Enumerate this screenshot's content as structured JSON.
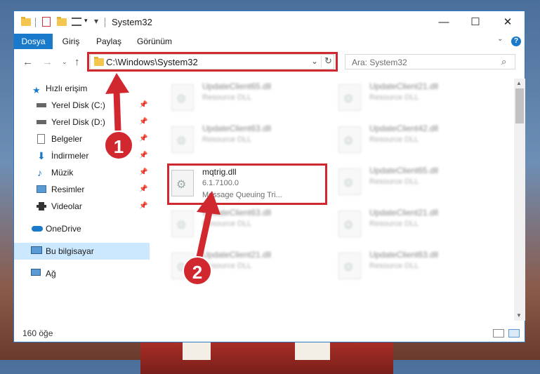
{
  "window": {
    "title": "System32"
  },
  "ribbon": {
    "tabs": [
      "Dosya",
      "Giriş",
      "Paylaş",
      "Görünüm"
    ],
    "help_label": "?"
  },
  "address": {
    "path": "C:\\Windows\\System32",
    "search_placeholder": "Ara: System32"
  },
  "sidebar": {
    "items": [
      {
        "label": "Hızlı erişim",
        "icon": "star-icon",
        "pinned": false
      },
      {
        "label": "Yerel Disk (C:)",
        "icon": "drive-icon",
        "pinned": true
      },
      {
        "label": "Yerel Disk (D:)",
        "icon": "drive-icon",
        "pinned": true
      },
      {
        "label": "Belgeler",
        "icon": "documents-icon",
        "pinned": true
      },
      {
        "label": "İndirmeler",
        "icon": "download-icon",
        "pinned": true
      },
      {
        "label": "Müzik",
        "icon": "music-icon",
        "pinned": true
      },
      {
        "label": "Resimler",
        "icon": "pictures-icon",
        "pinned": true
      },
      {
        "label": "Videolar",
        "icon": "videos-icon",
        "pinned": true
      },
      {
        "label": "OneDrive",
        "icon": "cloud-icon",
        "pinned": false
      },
      {
        "label": "Bu bilgisayar",
        "icon": "computer-icon",
        "pinned": false
      },
      {
        "label": "Ağ",
        "icon": "network-icon",
        "pinned": false
      }
    ]
  },
  "files": {
    "left": [
      {
        "name": "UpdateClient65.dll",
        "type": "Resource DLL"
      },
      {
        "name": "UpdateClient63.dll",
        "type": "Resource DLL"
      },
      {
        "name": "mqtrig.dll",
        "version": "6.1.7100.0",
        "description": "Message Queuing Tri..."
      },
      {
        "name": "UpdateClient63.dll",
        "type": "Resource DLL"
      },
      {
        "name": "UpdateClient21.dll",
        "type": "Resource DLL"
      }
    ],
    "right": [
      {
        "name": "UpdateClient21.dll",
        "type": "Resource DLL"
      },
      {
        "name": "UpdateClient42.dll",
        "type": "Resource DLL"
      },
      {
        "name": "UpdateClient65.dll",
        "type": "Resource DLL"
      },
      {
        "name": "UpdateClient21.dll",
        "type": "Resource DLL"
      },
      {
        "name": "UpdateClient63.dll",
        "type": "Resource DLL"
      }
    ]
  },
  "status": {
    "item_count": "160 öğe"
  },
  "annotations": {
    "step1": "1",
    "step2": "2",
    "highlight_color": "#d0282e"
  }
}
